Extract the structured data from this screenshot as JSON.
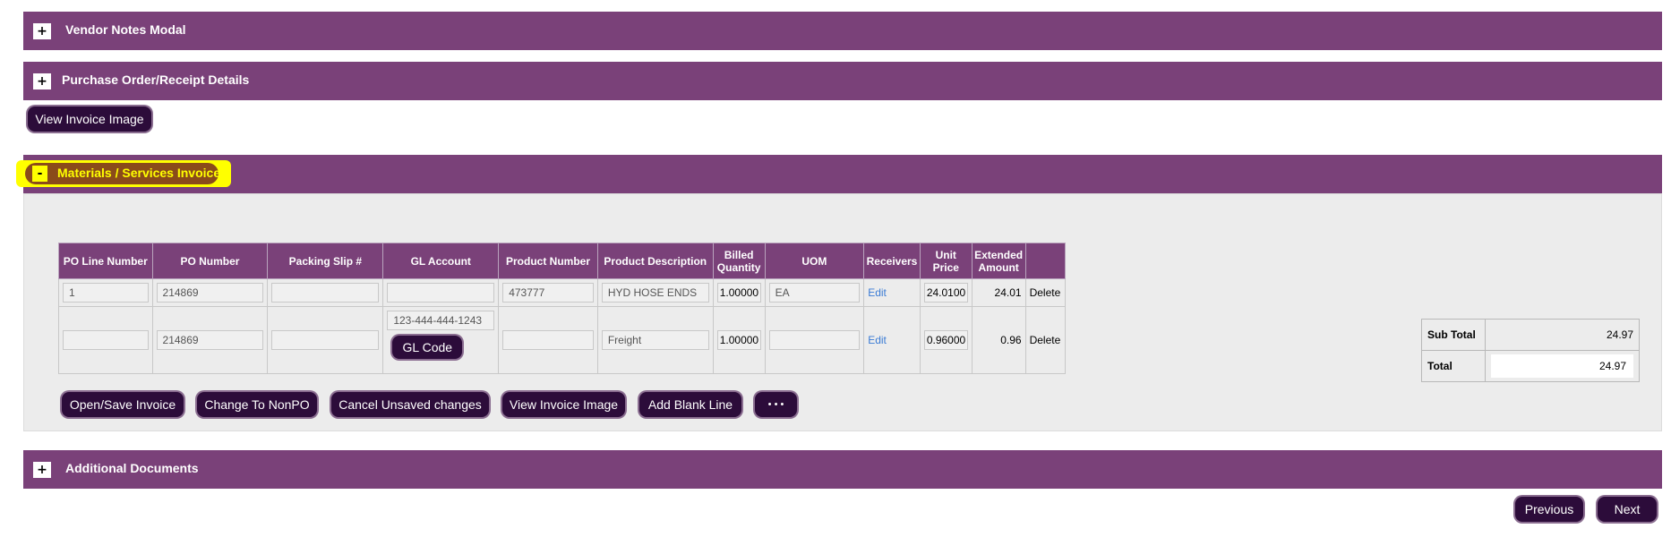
{
  "sections": {
    "vendor_notes": {
      "toggle": "+",
      "title": "Vendor Notes Modal"
    },
    "po_receipt": {
      "toggle": "+",
      "title": "Purchase Order/Receipt Details"
    },
    "materials": {
      "toggle": "-",
      "title": "Materials / Services Invoiced"
    },
    "additional_docs": {
      "toggle": "+",
      "title": "Additional Documents"
    }
  },
  "view_invoice_image_top": "View Invoice Image",
  "table": {
    "headers": [
      "PO Line Number",
      "PO Number",
      "Packing Slip #",
      "GL Account",
      "Product Number",
      "Product Description",
      "Billed Quantity",
      "UOM",
      "Receivers",
      "Unit Price",
      "Extended Amount",
      ""
    ],
    "rows": [
      {
        "po_line": "1",
        "po_number": "214869",
        "packing_slip": "",
        "gl_account": "",
        "product_number": "473777",
        "description": "HYD HOSE ENDS",
        "billed_qty": "1.00000",
        "uom": "EA",
        "receivers": "Edit",
        "unit_price": "24.0100",
        "extended": "24.01",
        "action": "Delete"
      },
      {
        "po_line": "",
        "po_number": "214869",
        "packing_slip": "",
        "gl_account": "123-444-444-1243",
        "gl_code_button": "GL Code",
        "product_number": "",
        "description": "Freight",
        "billed_qty": "1.00000",
        "uom": "",
        "receivers": "Edit",
        "unit_price": "0.96000",
        "extended": "0.96",
        "action": "Delete"
      }
    ]
  },
  "actions": {
    "open_save": "Open/Save Invoice",
    "change_nonpo": "Change To NonPO",
    "cancel_unsaved": "Cancel Unsaved changes",
    "view_invoice_image": "View Invoice Image",
    "add_blank_line": "Add Blank Line",
    "more": "• • •"
  },
  "totals": {
    "sub_total_label": "Sub Total",
    "sub_total_value": "24.97",
    "total_label": "Total",
    "total_value": "24.97"
  },
  "nav": {
    "previous": "Previous",
    "next": "Next"
  },
  "colors": {
    "header_purple": "#7a4179",
    "button_dark": "#2c0c3a",
    "highlight_yellow": "#ffff00",
    "highlight_brown": "#8a4b1a"
  }
}
